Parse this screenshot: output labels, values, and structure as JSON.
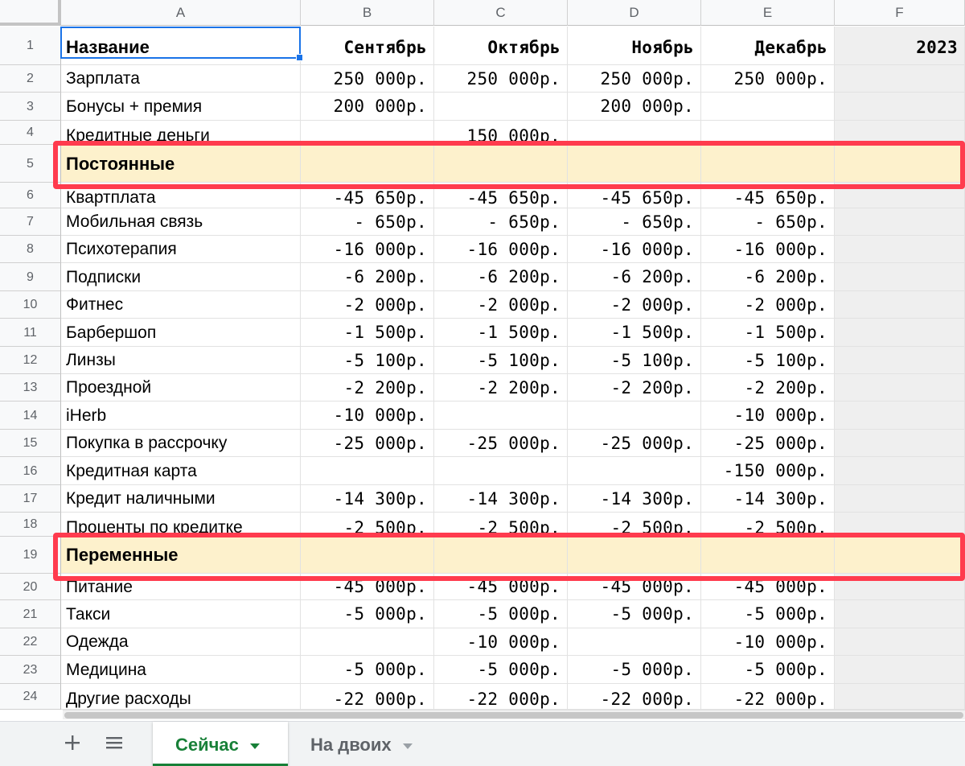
{
  "columns": [
    "A",
    "B",
    "C",
    "D",
    "E",
    "F"
  ],
  "rows": [
    {
      "num": "1",
      "type": "header",
      "cells": [
        "Название",
        "Сентябрь",
        "Октябрь",
        "Ноябрь",
        "Декабрь",
        "2023"
      ]
    },
    {
      "num": "2",
      "type": "data",
      "cells": [
        "Зарплата",
        "250 000р.",
        "250 000р.",
        "250 000р.",
        "250 000р.",
        ""
      ]
    },
    {
      "num": "3",
      "type": "data",
      "cells": [
        "Бонусы + премия",
        "200 000р.",
        "",
        "200 000р.",
        "",
        ""
      ]
    },
    {
      "num": "4",
      "type": "data",
      "cells": [
        "Кредитные деньги",
        "",
        "150 000р.",
        "",
        "",
        ""
      ]
    },
    {
      "num": "5",
      "type": "section",
      "cells": [
        "Постоянные",
        "",
        "",
        "",
        "",
        ""
      ]
    },
    {
      "num": "6",
      "type": "data",
      "cells": [
        "Квартплата",
        "-45 650р.",
        "-45 650р.",
        "-45 650р.",
        "-45 650р.",
        ""
      ]
    },
    {
      "num": "7",
      "type": "data",
      "cells": [
        "Мобильная связь",
        "-   650р.",
        "-   650р.",
        "-   650р.",
        "-   650р.",
        ""
      ]
    },
    {
      "num": "8",
      "type": "data",
      "cells": [
        "Психотерапия",
        "-16 000р.",
        "-16 000р.",
        "-16 000р.",
        "-16 000р.",
        ""
      ]
    },
    {
      "num": "9",
      "type": "data",
      "cells": [
        "Подписки",
        "-6 200р.",
        "-6 200р.",
        "-6 200р.",
        "-6 200р.",
        ""
      ]
    },
    {
      "num": "10",
      "type": "data",
      "cells": [
        "Фитнес",
        "-2 000р.",
        "-2 000р.",
        "-2 000р.",
        "-2 000р.",
        ""
      ]
    },
    {
      "num": "11",
      "type": "data",
      "cells": [
        "Барбершоп",
        "-1 500р.",
        "-1 500р.",
        "-1 500р.",
        "-1 500р.",
        ""
      ]
    },
    {
      "num": "12",
      "type": "data",
      "cells": [
        "Линзы",
        "-5 100р.",
        "-5 100р.",
        "-5 100р.",
        "-5 100р.",
        ""
      ]
    },
    {
      "num": "13",
      "type": "data",
      "cells": [
        "Проездной",
        "-2 200р.",
        "-2 200р.",
        "-2 200р.",
        "-2 200р.",
        ""
      ]
    },
    {
      "num": "14",
      "type": "data",
      "cells": [
        "iHerb",
        "-10 000р.",
        "",
        "",
        "-10 000р.",
        ""
      ]
    },
    {
      "num": "15",
      "type": "data",
      "cells": [
        "Покупка в рассрочку",
        "-25 000р.",
        "-25 000р.",
        "-25 000р.",
        "-25 000р.",
        ""
      ]
    },
    {
      "num": "16",
      "type": "data",
      "cells": [
        "Кредитная карта",
        "",
        "",
        "",
        "-150 000р.",
        ""
      ]
    },
    {
      "num": "17",
      "type": "data",
      "cells": [
        "Кредит наличными",
        "-14 300р.",
        "-14 300р.",
        "-14 300р.",
        "-14 300р.",
        ""
      ]
    },
    {
      "num": "18",
      "type": "data",
      "cells": [
        "Проценты по кредитке",
        "-2 500р.",
        "-2 500р.",
        "-2 500р.",
        "-2 500р.",
        ""
      ]
    },
    {
      "num": "19",
      "type": "section",
      "cells": [
        "Переменные",
        "",
        "",
        "",
        "",
        ""
      ]
    },
    {
      "num": "20",
      "type": "data",
      "cells": [
        "Питание",
        "-45 000р.",
        "-45 000р.",
        "-45 000р.",
        "-45 000р.",
        ""
      ]
    },
    {
      "num": "21",
      "type": "data",
      "cells": [
        "Такси",
        "-5 000р.",
        "-5 000р.",
        "-5 000р.",
        "-5 000р.",
        ""
      ]
    },
    {
      "num": "22",
      "type": "data",
      "cells": [
        "Одежда",
        "",
        "-10 000р.",
        "",
        "-10 000р.",
        ""
      ]
    },
    {
      "num": "23",
      "type": "data",
      "cells": [
        "Медицина",
        "-5 000р.",
        "-5 000р.",
        "-5 000р.",
        "-5 000р.",
        ""
      ]
    },
    {
      "num": "24",
      "type": "data",
      "cells": [
        "Другие расходы",
        "-22 000р.",
        "-22 000р.",
        "-22 000р.",
        "-22 000р.",
        ""
      ]
    }
  ],
  "highlighted_rows": [
    "5",
    "19"
  ],
  "selected_cell": "A1",
  "tabs": [
    {
      "label": "Сейчас",
      "active": true
    },
    {
      "label": "На двоих",
      "active": false
    }
  ],
  "toolbar": {
    "add_icon": "plus-icon",
    "list_icon": "list-icon"
  },
  "colors": {
    "accent": "#1a73e8",
    "section_fill": "#fdf1cc",
    "highlight": "#ff3b4e",
    "active_tab": "#188038"
  }
}
